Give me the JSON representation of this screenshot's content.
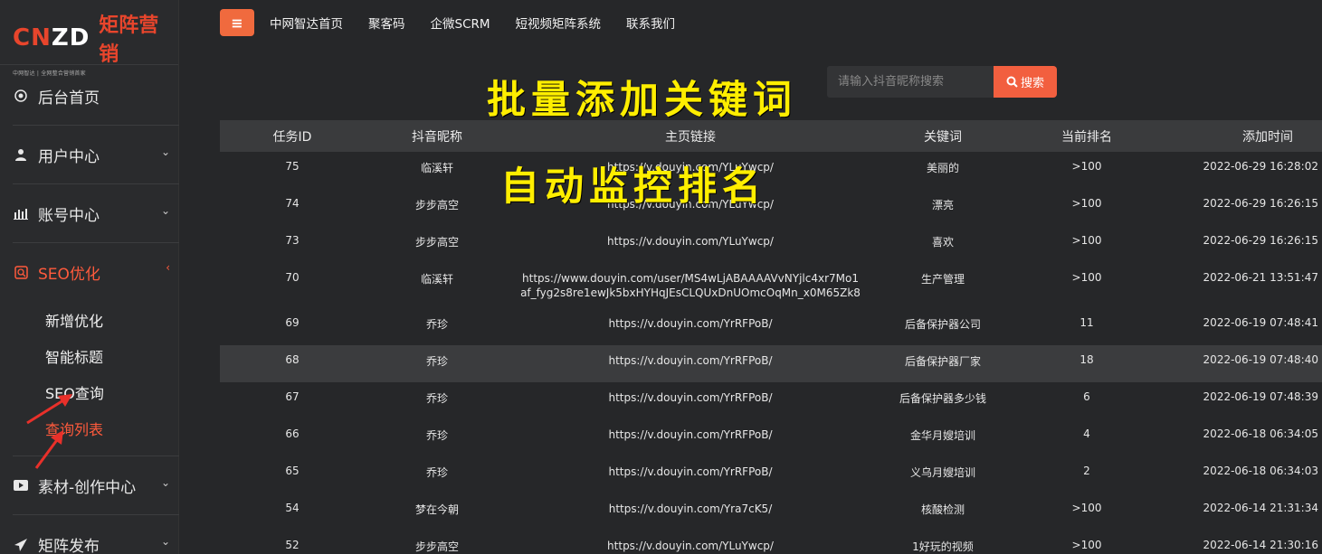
{
  "logo": {
    "cn": "CN",
    "zd": "ZD",
    "title": "矩阵营销",
    "subtitle": "中网智达 | 全网整合营销首家"
  },
  "sidebar": {
    "items": [
      {
        "label": "后台首页",
        "icon": "target-icon"
      },
      {
        "label": "用户中心",
        "icon": "user-icon"
      },
      {
        "label": "账号中心",
        "icon": "bar-chart-icon"
      },
      {
        "label": "SEO优化",
        "icon": "seo-icon",
        "active": true
      },
      {
        "label": "素材-创作中心",
        "icon": "video-icon"
      },
      {
        "label": "矩阵发布",
        "icon": "send-icon"
      }
    ],
    "seo_sub": [
      "新增优化",
      "智能标题",
      "SEO查询",
      "查询列表"
    ]
  },
  "topnav": {
    "menu_icon": "≡",
    "links": [
      "中网智达首页",
      "聚客码",
      "企微SCRM",
      "短视频矩阵系统",
      "联系我们"
    ]
  },
  "overlay": {
    "line1": "批量添加关键词",
    "line2": "自动监控排名"
  },
  "search": {
    "placeholder": "请输入抖音昵称搜索",
    "button": "搜索"
  },
  "table": {
    "headers": [
      "任务ID",
      "抖音昵称",
      "主页链接",
      "关键词",
      "当前排名",
      "添加时间"
    ],
    "rows": [
      {
        "id": "75",
        "nick": "临溪轩",
        "link": "https://v.douyin.com/YLuYwcp/",
        "kw": "美丽的",
        "rank": ">100",
        "time": "2022-06-29 16:28:02"
      },
      {
        "id": "74",
        "nick": "步步高空",
        "link": "https://v.douyin.com/YLuYwcp/",
        "kw": "漂亮",
        "rank": ">100",
        "time": "2022-06-29 16:26:15"
      },
      {
        "id": "73",
        "nick": "步步高空",
        "link": "https://v.douyin.com/YLuYwcp/",
        "kw": "喜欢",
        "rank": ">100",
        "time": "2022-06-29 16:26:15"
      },
      {
        "id": "70",
        "nick": "临溪轩",
        "link": "https://www.douyin.com/user/MS4wLjABAAAAVvNYjlc4xr7Mo1af_fyg2s8re1ewJk5bxHYHqJEsCLQUxDnUOmcOqMn_x0M65Zk8",
        "kw": "生产管理",
        "rank": ">100",
        "time": "2022-06-21 13:51:47"
      },
      {
        "id": "69",
        "nick": "乔珍",
        "link": "https://v.douyin.com/YrRFPoB/",
        "kw": "后备保护器公司",
        "rank": "11",
        "time": "2022-06-19 07:48:41"
      },
      {
        "id": "68",
        "nick": "乔珍",
        "link": "https://v.douyin.com/YrRFPoB/",
        "kw": "后备保护器厂家",
        "rank": "18",
        "time": "2022-06-19 07:48:40"
      },
      {
        "id": "67",
        "nick": "乔珍",
        "link": "https://v.douyin.com/YrRFPoB/",
        "kw": "后备保护器多少钱",
        "rank": "6",
        "time": "2022-06-19 07:48:39"
      },
      {
        "id": "66",
        "nick": "乔珍",
        "link": "https://v.douyin.com/YrRFPoB/",
        "kw": "金华月嫂培训",
        "rank": "4",
        "time": "2022-06-18 06:34:05"
      },
      {
        "id": "65",
        "nick": "乔珍",
        "link": "https://v.douyin.com/YrRFPoB/",
        "kw": "义乌月嫂培训",
        "rank": "2",
        "time": "2022-06-18 06:34:03"
      },
      {
        "id": "54",
        "nick": "梦在今朝",
        "link": "https://v.douyin.com/Yra7cK5/",
        "kw": "核酸检测",
        "rank": ">100",
        "time": "2022-06-14 21:31:34"
      },
      {
        "id": "52",
        "nick": "步步高空",
        "link": "https://v.douyin.com/YLuYwcp/",
        "kw": "1好玩的视频",
        "rank": ">100",
        "time": "2022-06-14 21:30:16"
      }
    ]
  },
  "colors": {
    "accent": "#f25f3f",
    "overlay_text": "#ffee00",
    "background": "#262729"
  }
}
